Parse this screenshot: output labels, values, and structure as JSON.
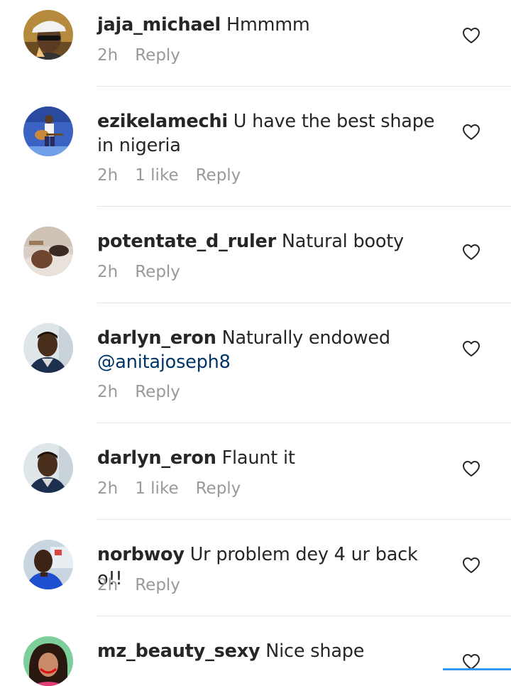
{
  "comments": [
    {
      "username": "jaja_michael",
      "text": "Hmmmm",
      "mention": "",
      "time": "2h",
      "likes": "",
      "reply_label": "Reply",
      "avatar": "avatar-cap-man"
    },
    {
      "username": "ezikelamechi",
      "text": "U have the best shape in nigeria",
      "mention": "",
      "time": "2h",
      "likes": "1 like",
      "reply_label": "Reply",
      "avatar": "avatar-guitarist"
    },
    {
      "username": "potentate_d_ruler",
      "text": "Natural booty",
      "mention": "",
      "time": "2h",
      "likes": "",
      "reply_label": "Reply",
      "avatar": "avatar-lying-man"
    },
    {
      "username": "darlyn_eron",
      "text": "Naturally endowed",
      "mention": "@anitajoseph8",
      "time": "2h",
      "likes": "",
      "reply_label": "Reply",
      "avatar": "avatar-man-portrait"
    },
    {
      "username": "darlyn_eron",
      "text": "Flaunt it",
      "mention": "",
      "time": "2h",
      "likes": "1 like",
      "reply_label": "Reply",
      "avatar": "avatar-man-portrait"
    },
    {
      "username": "norbwoy",
      "text": "Ur problem dey 4 ur back o!!",
      "mention": "",
      "time": "2h",
      "likes": "",
      "reply_label": "Reply",
      "avatar": "avatar-blue-shirt"
    },
    {
      "username": "mz_beauty_sexy",
      "text": "Nice shape",
      "mention": "",
      "time": "",
      "likes": "",
      "reply_label": "",
      "avatar": "avatar-woman"
    }
  ],
  "colors": {
    "username": "#262626",
    "text": "#262626",
    "meta": "#999999",
    "mention": "#003569",
    "divider": "#e4e4e4",
    "accent": "#3897f0"
  },
  "icons": {
    "like": "heart-outline-icon"
  }
}
